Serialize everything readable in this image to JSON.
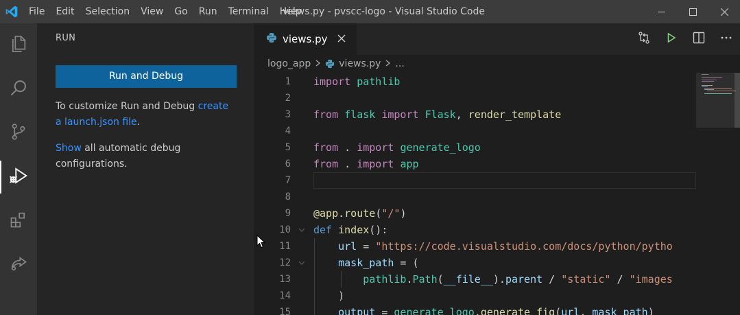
{
  "window": {
    "title": "views.py - pvscc-logo - Visual Studio Code",
    "menu": [
      "File",
      "Edit",
      "Selection",
      "View",
      "Go",
      "Run",
      "Terminal",
      "Help"
    ]
  },
  "activity_bar": {
    "items": [
      {
        "name": "explorer",
        "icon": "files-icon"
      },
      {
        "name": "search",
        "icon": "search-icon"
      },
      {
        "name": "source-control",
        "icon": "source-control-icon"
      },
      {
        "name": "run",
        "icon": "run-debug-icon",
        "active": true
      },
      {
        "name": "extensions",
        "icon": "extensions-icon"
      },
      {
        "name": "remote",
        "icon": "live-share-icon"
      }
    ]
  },
  "sidebar": {
    "title": "RUN",
    "run_button": "Run and Debug",
    "p1_text": "To customize Run and Debug ",
    "p1_link_a": "create",
    "p1_link_b": "a launch.json file",
    "p1_end": ".",
    "p2_link": "Show",
    "p2_text_a": " all automatic debug",
    "p2_text_b": "configurations."
  },
  "tabs": [
    {
      "label": "views.py",
      "icon": "python-file-icon",
      "active": true
    }
  ],
  "breadcrumbs": {
    "folder": "logo_app",
    "file": "views.py",
    "more": "..."
  },
  "editor": {
    "current_line": 7,
    "lines": [
      {
        "n": "1",
        "tokens": [
          [
            "k",
            "import"
          ],
          [
            "p",
            " "
          ],
          [
            "m",
            "pathlib"
          ]
        ]
      },
      {
        "n": "2",
        "tokens": []
      },
      {
        "n": "3",
        "tokens": [
          [
            "k",
            "from"
          ],
          [
            "p",
            " "
          ],
          [
            "m",
            "flask"
          ],
          [
            "p",
            " "
          ],
          [
            "k",
            "import"
          ],
          [
            "p",
            " "
          ],
          [
            "m",
            "Flask"
          ],
          [
            "p",
            ", "
          ],
          [
            "f",
            "render_template"
          ]
        ]
      },
      {
        "n": "4",
        "tokens": []
      },
      {
        "n": "5",
        "tokens": [
          [
            "k",
            "from"
          ],
          [
            "p",
            " . "
          ],
          [
            "k",
            "import"
          ],
          [
            "p",
            " "
          ],
          [
            "m",
            "generate_logo"
          ]
        ]
      },
      {
        "n": "6",
        "tokens": [
          [
            "k",
            "from"
          ],
          [
            "p",
            " . "
          ],
          [
            "k",
            "import"
          ],
          [
            "p",
            " "
          ],
          [
            "m",
            "app"
          ]
        ]
      },
      {
        "n": "7",
        "tokens": []
      },
      {
        "n": "8",
        "tokens": []
      },
      {
        "n": "9",
        "tokens": [
          [
            "f",
            "@app"
          ],
          [
            "p",
            "."
          ],
          [
            "f",
            "route"
          ],
          [
            "p",
            "("
          ],
          [
            "s",
            "\"/\""
          ],
          [
            "p",
            ")"
          ]
        ]
      },
      {
        "n": "10",
        "fold": true,
        "tokens": [
          [
            "kd",
            "def"
          ],
          [
            "p",
            " "
          ],
          [
            "f",
            "index"
          ],
          [
            "p",
            "():"
          ]
        ]
      },
      {
        "n": "11",
        "tokens": [
          [
            "p",
            "    "
          ],
          [
            "v",
            "url"
          ],
          [
            "p",
            " = "
          ],
          [
            "s",
            "\"https://code.visualstudio.com/docs/python/pytho"
          ]
        ]
      },
      {
        "n": "12",
        "fold": true,
        "tokens": [
          [
            "p",
            "    "
          ],
          [
            "v",
            "mask_path"
          ],
          [
            "p",
            " = ("
          ]
        ]
      },
      {
        "n": "13",
        "tokens": [
          [
            "p",
            "        "
          ],
          [
            "m",
            "pathlib"
          ],
          [
            "p",
            "."
          ],
          [
            "m",
            "Path"
          ],
          [
            "p",
            "("
          ],
          [
            "v",
            "__file__"
          ],
          [
            "p",
            ")."
          ],
          [
            "v",
            "parent"
          ],
          [
            "p",
            " / "
          ],
          [
            "s",
            "\"static\""
          ],
          [
            "p",
            " / "
          ],
          [
            "s",
            "\"images"
          ]
        ]
      },
      {
        "n": "14",
        "tokens": [
          [
            "p",
            "    )"
          ]
        ]
      },
      {
        "n": "15",
        "tokens": [
          [
            "p",
            "    "
          ],
          [
            "v",
            "output"
          ],
          [
            "p",
            " = "
          ],
          [
            "m",
            "generate_logo"
          ],
          [
            "p",
            "."
          ],
          [
            "f",
            "generate_fig"
          ],
          [
            "p",
            "("
          ],
          [
            "v",
            "url"
          ],
          [
            "p",
            ", "
          ],
          [
            "v",
            "mask_path"
          ],
          [
            "p",
            ")"
          ]
        ]
      }
    ]
  }
}
